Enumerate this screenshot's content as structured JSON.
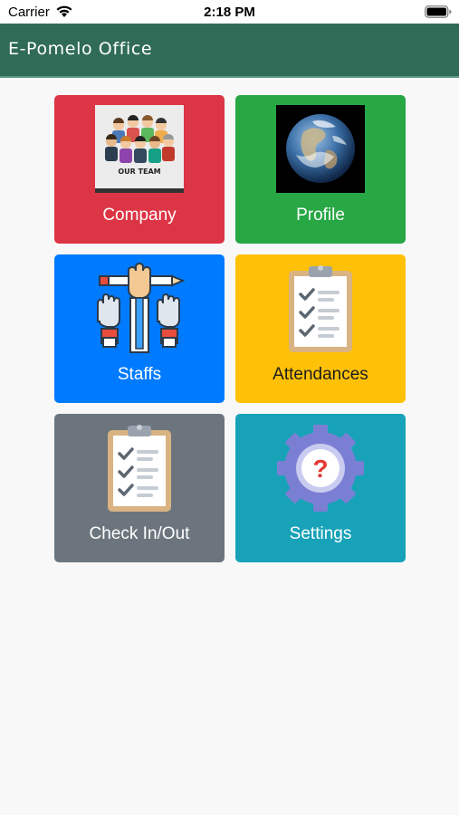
{
  "status_bar": {
    "carrier": "Carrier",
    "time": "2:18 PM"
  },
  "app_bar": {
    "title": "E-Pomelo Office"
  },
  "tiles": [
    {
      "label": "Company",
      "color": "#dc3545",
      "icon": "our-team-image",
      "image_text": "OUR TEAM"
    },
    {
      "label": "Profile",
      "color": "#28a745",
      "icon": "earth-image"
    },
    {
      "label": "Staffs",
      "color": "#007bff",
      "icon": "raised-hands-pencil-icon"
    },
    {
      "label": "Attendances",
      "color": "#ffc107",
      "icon": "clipboard-checklist-icon"
    },
    {
      "label": "Check In/Out",
      "color": "#6c757d",
      "icon": "clipboard-checklist-icon"
    },
    {
      "label": "Settings",
      "color": "#17a2b8",
      "icon": "gear-question-icon"
    }
  ]
}
